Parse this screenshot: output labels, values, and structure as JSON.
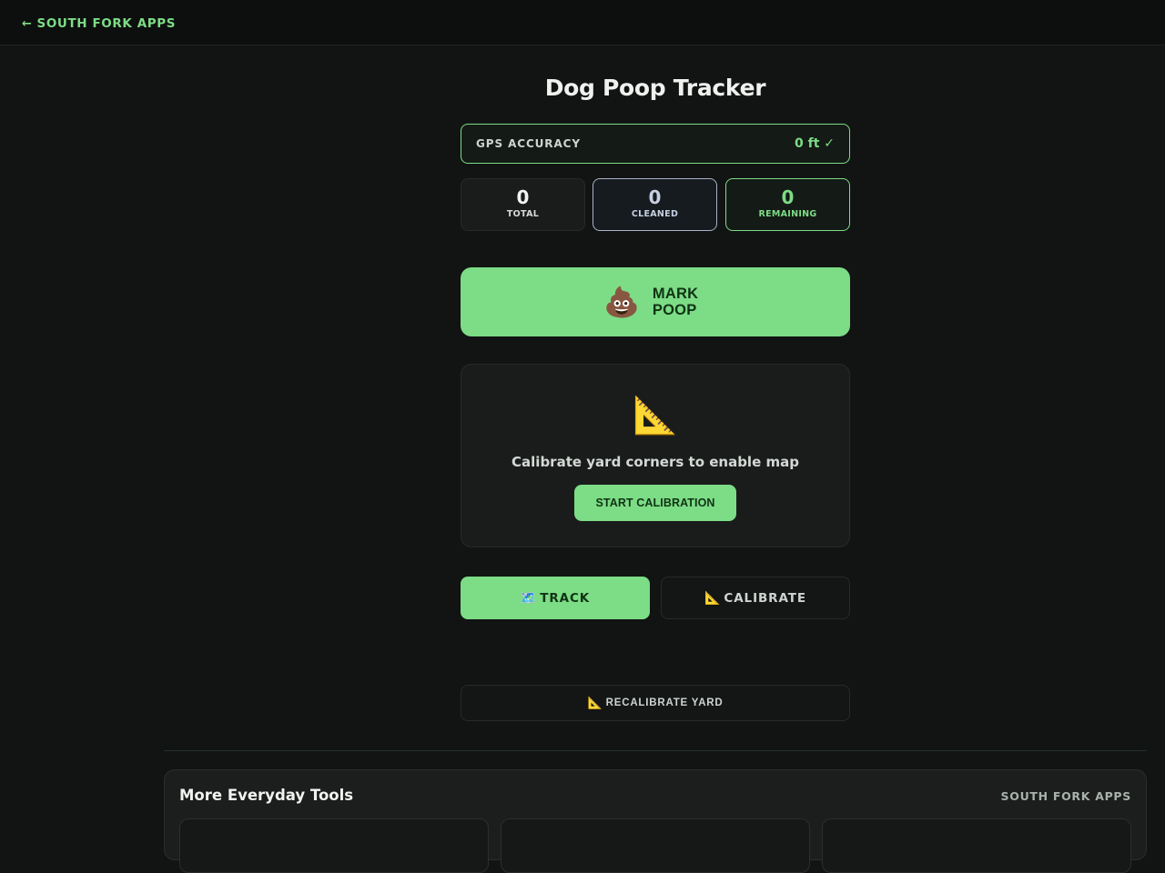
{
  "nav": {
    "back_arrow": "←",
    "back_label": "SOUTH FORK APPS"
  },
  "page": {
    "title": "Dog Poop Tracker"
  },
  "gps": {
    "label": "GPS ACCURACY",
    "value": "0 ft ✓"
  },
  "stats": {
    "total": {
      "value": "0",
      "label": "TOTAL"
    },
    "cleaned": {
      "value": "0",
      "label": "CLEANED"
    },
    "remaining": {
      "value": "0",
      "label": "REMAINING"
    }
  },
  "mark_button": {
    "icon": "💩",
    "line1": "MARK",
    "line2": "POOP"
  },
  "calibration": {
    "icon": "📐",
    "message": "Calibrate yard corners to enable map",
    "button_label": "START CALIBRATION"
  },
  "tabs": [
    {
      "icon": "🗺️",
      "label": "TRACK",
      "active": true
    },
    {
      "icon": "📐",
      "label": "CALIBRATE",
      "active": false
    }
  ],
  "recalibrate": {
    "icon": "📐",
    "label": "RECALIBRATE YARD"
  },
  "footer": {
    "title": "More Everyday Tools",
    "brand": "SOUTH FORK APPS"
  },
  "colors": {
    "accent": "#7ddc86",
    "background": "#111413",
    "card": "#1a1c1b",
    "cleaned_border": "#a9b3c6"
  }
}
